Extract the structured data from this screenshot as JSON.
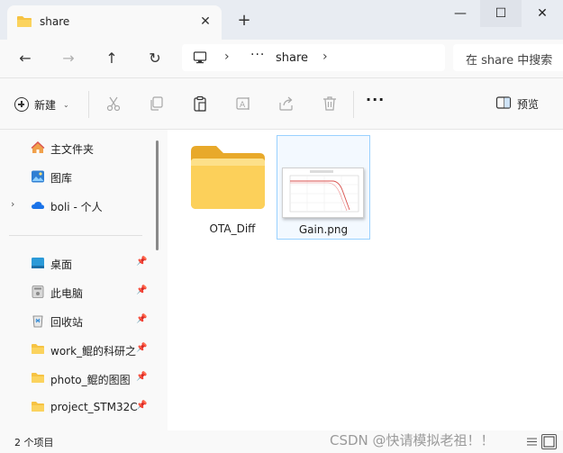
{
  "window": {
    "tab_title": "share",
    "tab_close": "✕",
    "new_tab": "+",
    "minimize": "—",
    "maximize": "☐",
    "close": "✕"
  },
  "nav": {
    "back": "←",
    "forward": "→",
    "up": "↑",
    "refresh": "↻",
    "address": {
      "separator": "›",
      "more": "···",
      "current": "share"
    },
    "search_placeholder": "在 share 中搜索"
  },
  "commands": {
    "new_label": "新建",
    "new_caret": "⌄",
    "more": "···",
    "preview_label": "预览"
  },
  "sidebar": {
    "items": [
      {
        "label": "主文件夹",
        "icon": "home-icon",
        "pinned": false
      },
      {
        "label": "图库",
        "icon": "gallery-icon",
        "pinned": false
      },
      {
        "label": "boli - 个人",
        "icon": "onedrive-icon",
        "pinned": false,
        "expandable": true
      },
      {
        "label": "桌面",
        "icon": "desktop-icon",
        "pinned": true
      },
      {
        "label": "此电脑",
        "icon": "this-pc-icon",
        "pinned": true
      },
      {
        "label": "回收站",
        "icon": "recycle-bin-icon",
        "pinned": true
      },
      {
        "label": "work_鲲的科研之",
        "icon": "folder-icon",
        "pinned": true
      },
      {
        "label": "photo_鲲的图图",
        "icon": "folder-icon",
        "pinned": true
      },
      {
        "label": "project_STM32C",
        "icon": "folder-icon",
        "pinned": true
      }
    ],
    "expand_glyph": "›",
    "pin_glyph": "📌"
  },
  "files": [
    {
      "name": "OTA_Diff",
      "type": "folder",
      "selected": false
    },
    {
      "name": "Gain.png",
      "type": "image",
      "selected": true
    }
  ],
  "status": {
    "count": "2 个项目",
    "watermark": "CSDN @快请模拟老祖！！"
  },
  "colors": {
    "folder": "#f6c343",
    "folder_dark": "#e8a92a",
    "selection_border": "#99d1ff",
    "accent": "#0a64c8"
  }
}
